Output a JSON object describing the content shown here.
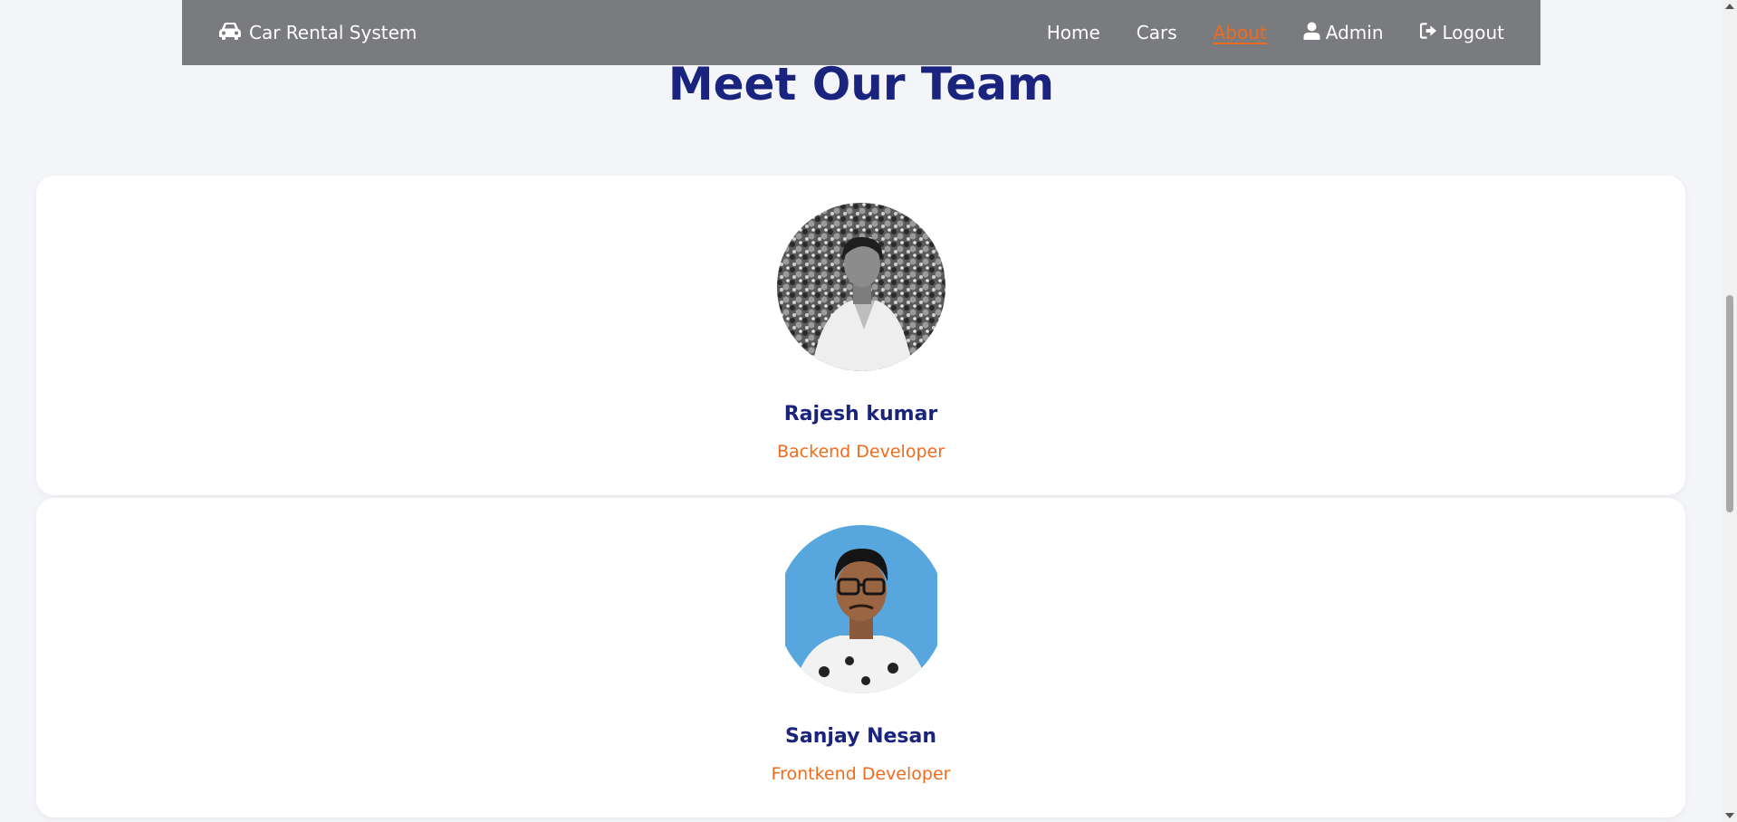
{
  "navbar": {
    "brand_icon": "car-icon",
    "brand": "Car Rental System",
    "links": [
      {
        "label": "Home",
        "active": false
      },
      {
        "label": "Cars",
        "active": false
      },
      {
        "label": "About",
        "active": true
      },
      {
        "label": "Admin",
        "icon": "user-icon",
        "active": false
      },
      {
        "label": "Logout",
        "icon": "logout-icon",
        "active": false
      }
    ]
  },
  "main": {
    "title": "Meet Our Team",
    "team": [
      {
        "name": "Rajesh kumar",
        "role": "Backend Developer"
      },
      {
        "name": "Sanjay Nesan",
        "role": "Frontkend Developer"
      }
    ]
  },
  "colors": {
    "navbar_bg": "#7a7b7e",
    "accent": "#f26a1b",
    "title": "#1a237e",
    "page_bg": "#f4f5f9"
  }
}
